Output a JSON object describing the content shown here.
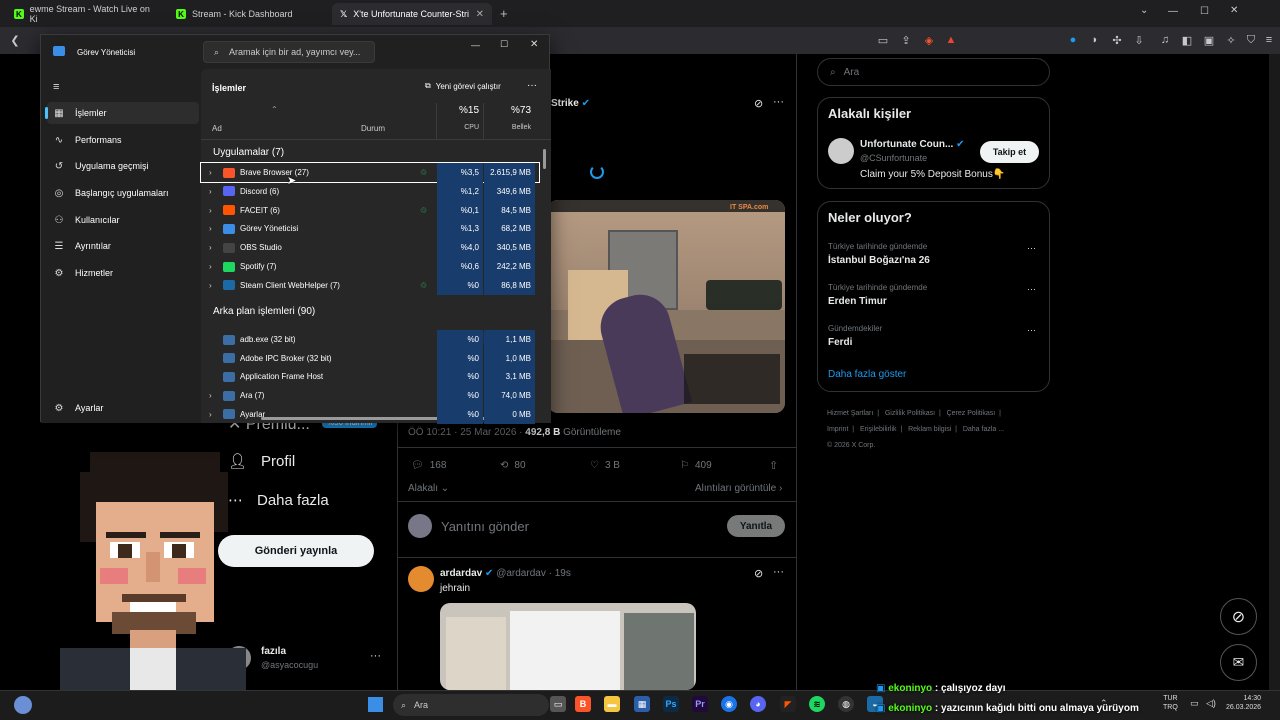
{
  "tabs": [
    {
      "label": "ewme Stream - Watch Live on Ki",
      "active": false
    },
    {
      "label": "Stream - Kick Dashboard",
      "active": false
    },
    {
      "label": "X'te Unfortunate Counter-Stri",
      "active": true
    }
  ],
  "left": {
    "premium": "Premiu...",
    "premium_badge": "%50 indirimli",
    "profile": "Profil",
    "more": "Daha fazla",
    "post": "Gönderi yayınla",
    "user_name": "fazıla",
    "user_handle": "@asyacocugu"
  },
  "tweet": {
    "title_fragment": "Strike",
    "meta": "ÖÖ 10:21 · 25 Mar 2026 · ",
    "views_count": "492,8 B",
    "views_label": " Görüntüleme",
    "replies": "168",
    "retweets": "80",
    "likes": "3 B",
    "bookmarks": "409",
    "relevant": "Alakalı",
    "quotes": "Alıntıları görüntüle",
    "reply_placeholder": "Yanıtını gönder",
    "reply_button": "Yanıtla",
    "video_ttl": "IT SPA.com"
  },
  "reply": {
    "name": "ardardav",
    "handle": "@ardardav · 19s",
    "text": "jehrain"
  },
  "right": {
    "search": "Ara",
    "people_title": "Alakalı kişiler",
    "person_name": "Unfortunate Coun...",
    "person_handle": "@CSunfortunate",
    "follow": "Takip et",
    "person_bio": "Claim your 5% Deposit Bonus👇",
    "trends_title": "Neler oluyor?",
    "trends": [
      {
        "ctx": "Türkiye tarihinde gündemde",
        "name": "İstanbul Boğazı'na 26"
      },
      {
        "ctx": "Türkiye tarihinde gündemde",
        "name": "Erden Timur"
      },
      {
        "ctx": "Gündemdekiler",
        "name": "Ferdi"
      }
    ],
    "show_more": "Daha fazla göster",
    "footer": [
      "Hizmet Şartları",
      "|",
      "Gizlilik Politikası",
      "|",
      "Çerez Politikası",
      "|",
      "Imprint",
      "|",
      "Erişilebilirlik",
      "|",
      "Reklam bilgisi",
      "|",
      "Daha fazla ...",
      "© 2026 X Corp."
    ]
  },
  "tm": {
    "title": "Görev Yöneticisi",
    "search": "Aramak için bir ad, yayımcı vey...",
    "heading": "İşlemler",
    "run_new": "Yeni görevi çalıştır",
    "col_name": "Ad",
    "col_status": "Durum",
    "cpu_pct": "%15",
    "cpu_label": "CPU",
    "mem_pct": "%73",
    "mem_label": "Bellek",
    "nav": [
      "İşlemler",
      "Performans",
      "Uygulama geçmişi",
      "Başlangıç uygulamaları",
      "Kullanıcılar",
      "Ayrıntılar",
      "Hizmetler"
    ],
    "settings": "Ayarlar",
    "apps_title": "Uygulamalar (7)",
    "apps": [
      {
        "name": "Brave Browser (27)",
        "cpu": "%3,5",
        "mem": "2.615,9 MB",
        "leaf": true,
        "color": "#fb542b"
      },
      {
        "name": "Discord (6)",
        "cpu": "%1,2",
        "mem": "349,6 MB",
        "leaf": false,
        "color": "#5865f2"
      },
      {
        "name": "FACEIT (6)",
        "cpu": "%0,1",
        "mem": "84,5 MB",
        "leaf": true,
        "color": "#ff5500"
      },
      {
        "name": "Görev Yöneticisi",
        "cpu": "%1,3",
        "mem": "68,2 MB",
        "leaf": false,
        "color": "#3a8ee6"
      },
      {
        "name": "OBS Studio",
        "cpu": "%4,0",
        "mem": "340,5 MB",
        "leaf": false,
        "color": "#444"
      },
      {
        "name": "Spotify (7)",
        "cpu": "%0,6",
        "mem": "242,2 MB",
        "leaf": false,
        "color": "#1ed760"
      },
      {
        "name": "Steam Client WebHelper (7)",
        "cpu": "%0",
        "mem": "86,8 MB",
        "leaf": true,
        "color": "#1b6aa5"
      }
    ],
    "bg_title": "Arka plan işlemleri (90)",
    "bg": [
      {
        "name": "adb.exe (32 bit)",
        "cpu": "%0",
        "mem": "1,1 MB",
        "chev": false
      },
      {
        "name": "Adobe IPC Broker (32 bit)",
        "cpu": "%0",
        "mem": "1,0 MB",
        "chev": false
      },
      {
        "name": "Application Frame Host",
        "cpu": "%0",
        "mem": "3,1 MB",
        "chev": false
      },
      {
        "name": "Ara (7)",
        "cpu": "%0",
        "mem": "74,0 MB",
        "chev": true
      },
      {
        "name": "Ayarlar",
        "cpu": "%0",
        "mem": "0 MB",
        "chev": true
      }
    ]
  },
  "taskbar": {
    "search": "Ara",
    "lang1": "TUR",
    "lang2": "TRQ",
    "time": "14:30",
    "date": "26.03.2026"
  },
  "chat": [
    {
      "user": "ekoninyo",
      "msg": " : çalışıyoz dayı"
    },
    {
      "user": "ekoninyo",
      "msg": " : yazıcının kağıdı bitti onu almaya yürüyom"
    }
  ]
}
